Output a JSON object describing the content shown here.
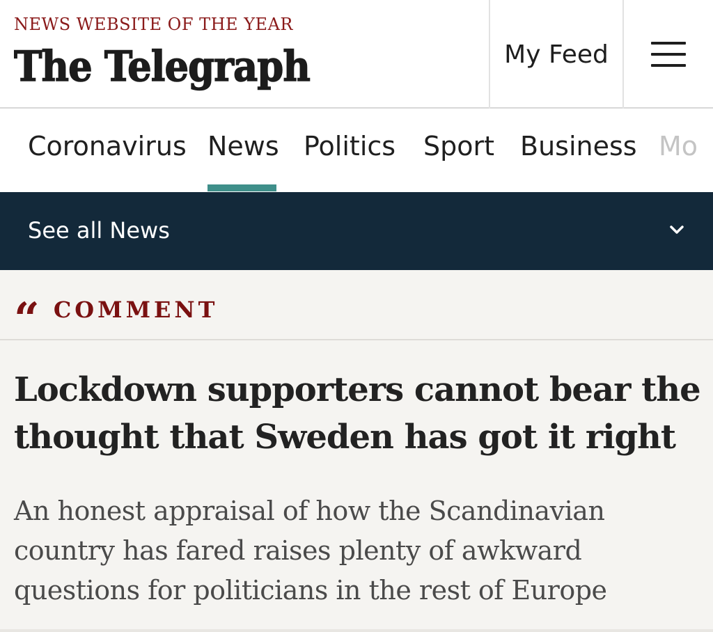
{
  "header": {
    "tagline": "NEWS WEBSITE OF THE YEAR",
    "logo_text": "The Telegraph",
    "my_feed_label": "My Feed",
    "menu_icon": "hamburger-menu-icon"
  },
  "primary_nav": {
    "items": [
      {
        "label": "Coronavirus"
      },
      {
        "label": "News",
        "active": true
      },
      {
        "label": "Politics"
      },
      {
        "label": "Sport"
      },
      {
        "label": "Business"
      },
      {
        "label": "Mo"
      }
    ],
    "active_color": "#3f8f8a"
  },
  "sub_nav": {
    "label": "See all News",
    "icon": "chevron-down-icon",
    "background": "#13293a"
  },
  "article": {
    "section_icon": "quote-icon",
    "section_quote": "“",
    "section_label": "COMMENT",
    "section_color": "#7a1111",
    "headline": "Lockdown supporters cannot bear the thought that Sweden has got it right",
    "standfirst": "An honest appraisal of how the Scandinavian country has fared raises plenty of awkward questions for politicians in the rest of Europe"
  }
}
